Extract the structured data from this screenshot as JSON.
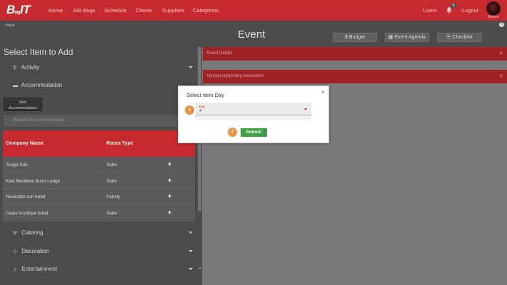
{
  "nav": {
    "logo_main": "B",
    "logo_sub": "ag",
    "logo_tail": "IT",
    "links": [
      "Home",
      "Job Bags",
      "Schedule",
      "Clients",
      "Suppliers",
      "Categories"
    ],
    "users": "Users",
    "notification_count": "3",
    "logout": "Logout",
    "admin": "Admin"
  },
  "header": {
    "back": "Back",
    "help": "?",
    "title": "Event",
    "buttons": {
      "budget": "Budget",
      "agenda": "Event Agenda",
      "checklist": "Checklist"
    }
  },
  "left": {
    "title": "Select Item to Add",
    "categories": {
      "activity": "Activity",
      "accommodation": "Accommodation",
      "catering": "Catering",
      "decoration": "Decoration",
      "entertainment": "Entertainment"
    },
    "add_button": {
      "line1": "Add",
      "line2": "Accommodation"
    },
    "search_placeholder": "Search for Accommodation",
    "table": {
      "headers": [
        "Company Name",
        "Room Type"
      ],
      "rows": [
        {
          "name": "Tsogo Sun",
          "type": "Suite",
          "action": "+"
        },
        {
          "name": "Kwa Maritane Bush Lodge",
          "type": "Suite",
          "action": "+"
        },
        {
          "name": "Riverside sun hotel",
          "type": "Family",
          "action": "+"
        },
        {
          "name": "Oasis boutique hotel",
          "type": "Suite",
          "action": "+"
        }
      ]
    }
  },
  "right": {
    "accordions": [
      {
        "label": "Event Details",
        "close": "×"
      },
      {
        "label": "Upload supporting documents",
        "close": "×"
      }
    ]
  },
  "modal": {
    "title": "Select Item Day",
    "close": "×",
    "step1": "1",
    "step2": "2",
    "day_label": "Day",
    "day_value": "4",
    "submit": "Submit"
  },
  "colors": {
    "brand": "#c62a2e",
    "submit": "#3fa043",
    "step": "#e6923e"
  }
}
